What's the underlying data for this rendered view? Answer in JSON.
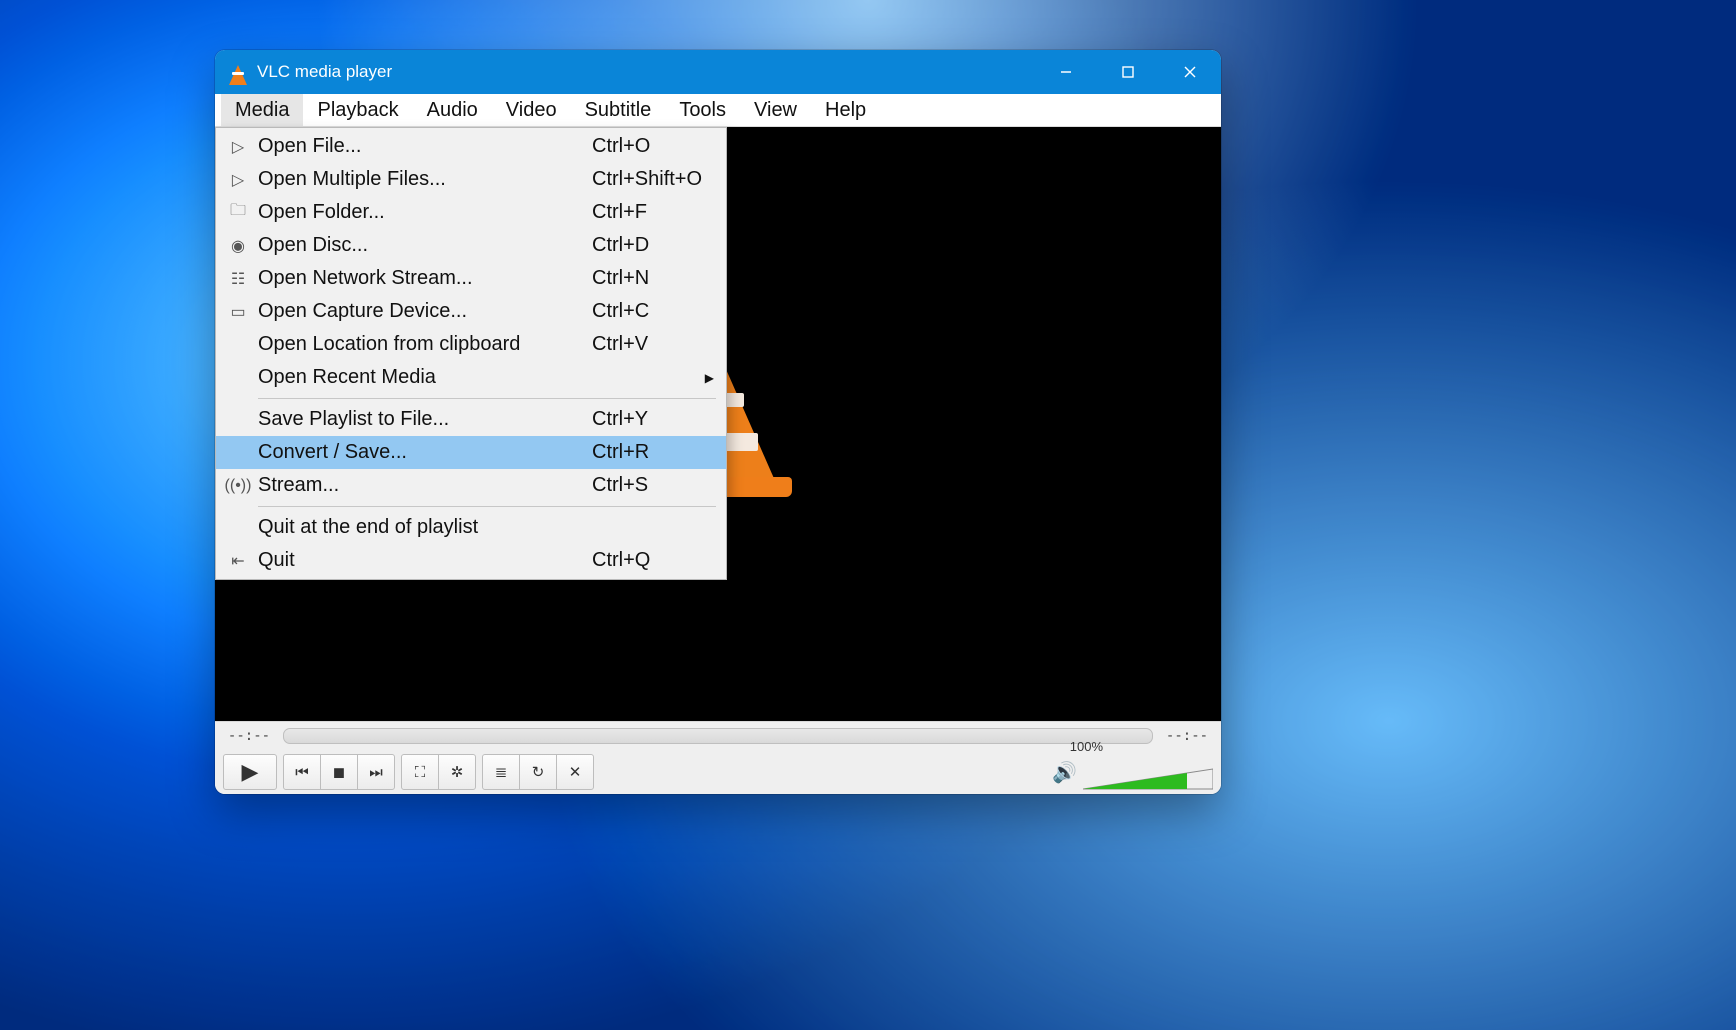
{
  "titlebar": {
    "title": "VLC media player"
  },
  "menubar": [
    "Media",
    "Playback",
    "Audio",
    "Video",
    "Subtitle",
    "Tools",
    "View",
    "Help"
  ],
  "open_menu_index": 0,
  "menu": {
    "groups": [
      [
        {
          "icon": "file-play",
          "label": "Open File...",
          "shortcut": "Ctrl+O"
        },
        {
          "icon": "file-play",
          "label": "Open Multiple Files...",
          "shortcut": "Ctrl+Shift+O"
        },
        {
          "icon": "folder",
          "label": "Open Folder...",
          "shortcut": "Ctrl+F"
        },
        {
          "icon": "disc",
          "label": "Open Disc...",
          "shortcut": "Ctrl+D"
        },
        {
          "icon": "network",
          "label": "Open Network Stream...",
          "shortcut": "Ctrl+N"
        },
        {
          "icon": "capture",
          "label": "Open Capture Device...",
          "shortcut": "Ctrl+C"
        },
        {
          "icon": "",
          "label": "Open Location from clipboard",
          "shortcut": "Ctrl+V"
        },
        {
          "icon": "",
          "label": "Open Recent Media",
          "shortcut": "",
          "submenu": true
        }
      ],
      [
        {
          "icon": "",
          "label": "Save Playlist to File...",
          "shortcut": "Ctrl+Y"
        },
        {
          "icon": "",
          "label": "Convert / Save...",
          "shortcut": "Ctrl+R",
          "selected": true
        },
        {
          "icon": "stream",
          "label": "Stream...",
          "shortcut": "Ctrl+S"
        }
      ],
      [
        {
          "icon": "",
          "label": "Quit at the end of playlist",
          "shortcut": ""
        },
        {
          "icon": "quit",
          "label": "Quit",
          "shortcut": "Ctrl+Q"
        }
      ]
    ]
  },
  "playback": {
    "elapsed": "--:--",
    "total": "--:--"
  },
  "controls": {
    "play": "▶",
    "group1": [
      "⏮",
      "◼",
      "⏭"
    ],
    "group2": [
      "⛶",
      "✲"
    ],
    "group3": [
      "≣",
      "↻",
      "✕"
    ],
    "volume_percent": "100%",
    "volume_value": 100
  }
}
